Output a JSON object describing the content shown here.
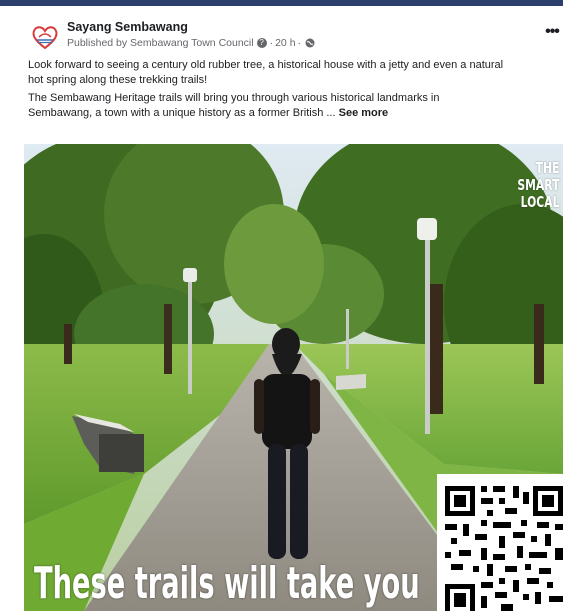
{
  "post": {
    "page_name": "Sayang Sembawang",
    "published_by": "Published by Sembawang Town Council",
    "time": "20 h",
    "more_icon": "ellipsis-icon",
    "verified_icon": "info-circle-icon",
    "audience_icon": "globe-icon",
    "paragraph1_line1": "Look forward to seeing a century old rubber tree, a historical house with a jetty and even a natural",
    "paragraph1_line2": "hot spring along these trekking trails!",
    "paragraph2_line1": "The Sembawang Heritage trails will bring you through various historical landmarks in",
    "paragraph2_line2": "Sembawang, a town with a unique history as a former British ...",
    "see_more": "See more"
  },
  "video": {
    "watermark_line1": "THE",
    "watermark_line2": "SMART",
    "watermark_line3": "LOCAL",
    "caption": "These trails will take you"
  },
  "colors": {
    "top_bar": "#2c3e6b",
    "text": "#1c1e21",
    "meta": "#65676b"
  }
}
